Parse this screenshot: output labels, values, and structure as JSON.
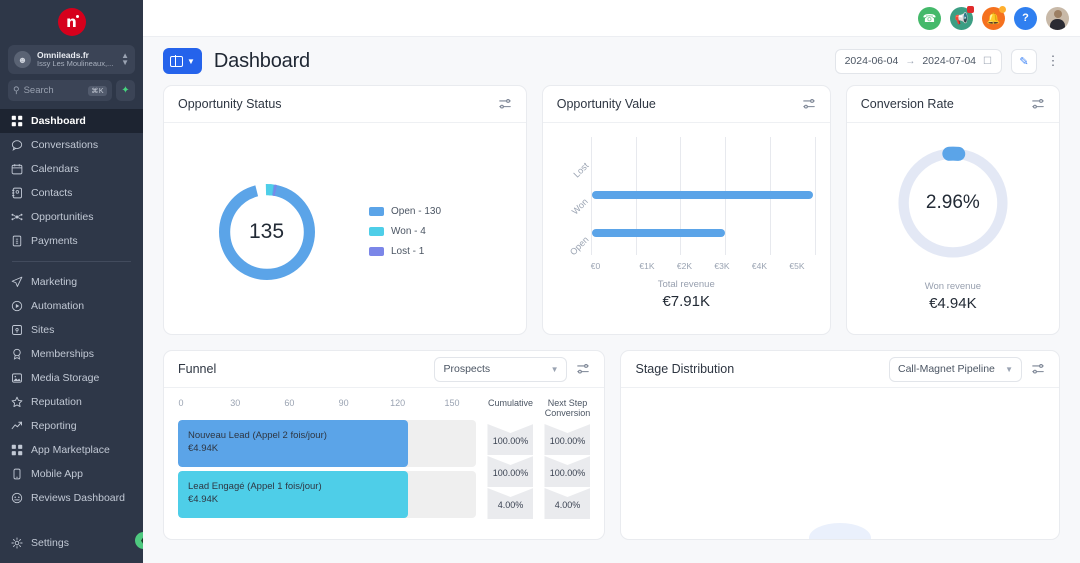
{
  "sidebar": {
    "logo_label": "n",
    "workspace": {
      "name": "Omnileads.fr",
      "location": "Issy Les Moulineaux,...",
      "avatar_icon": "user-circle-icon",
      "caret_icon": "chevron-updown-icon"
    },
    "search": {
      "placeholder": "Search",
      "shortcut": "⌘K",
      "icon": "search-icon",
      "spark_icon": "sparkle-icon"
    },
    "items": [
      {
        "label": "Dashboard",
        "icon": "grid-icon",
        "active": true
      },
      {
        "label": "Conversations",
        "icon": "chat-icon",
        "active": false
      },
      {
        "label": "Calendars",
        "icon": "calendar-icon",
        "active": false
      },
      {
        "label": "Contacts",
        "icon": "contacts-icon",
        "active": false
      },
      {
        "label": "Opportunities",
        "icon": "opportunities-icon",
        "active": false
      },
      {
        "label": "Payments",
        "icon": "payments-icon",
        "active": false
      }
    ],
    "items2": [
      {
        "label": "Marketing",
        "icon": "send-icon"
      },
      {
        "label": "Automation",
        "icon": "play-circle-icon"
      },
      {
        "label": "Sites",
        "icon": "sites-icon"
      },
      {
        "label": "Memberships",
        "icon": "badge-icon"
      },
      {
        "label": "Media Storage",
        "icon": "image-icon"
      },
      {
        "label": "Reputation",
        "icon": "star-icon"
      },
      {
        "label": "Reporting",
        "icon": "trend-up-icon"
      },
      {
        "label": "App Marketplace",
        "icon": "grid-icon"
      },
      {
        "label": "Mobile App",
        "icon": "mobile-icon"
      },
      {
        "label": "Reviews Dashboard",
        "icon": "gauge-icon"
      }
    ],
    "settings": {
      "label": "Settings",
      "icon": "gear-icon"
    },
    "collapse_icon": "chevron-left-icon"
  },
  "topbar": {
    "icons": [
      {
        "name": "phone-icon",
        "glyph": "✆",
        "color": "#44b96a",
        "badge": null
      },
      {
        "name": "megaphone-icon",
        "glyph": "📣",
        "color": "#3c9e83",
        "badge": "red"
      },
      {
        "name": "notifications-bell-icon",
        "glyph": "🔔",
        "color": "#f5711f",
        "badge": "orange"
      },
      {
        "name": "help-icon",
        "glyph": "?",
        "color": "#2f7ff0",
        "badge": null
      }
    ],
    "avatar_name": "user-avatar"
  },
  "header": {
    "view_button_label": "",
    "view_icon": "layout-panel-icon",
    "caret_icon": "chevron-down-icon",
    "title": "Dashboard",
    "date_start": "2024-06-04",
    "date_end": "2024-07-04",
    "date_arrow": "→",
    "calendar_icon": "calendar-icon",
    "edit_icon": "pencil-icon",
    "kebab_icon": "more-vertical-icon"
  },
  "cards": {
    "opportunity_status": {
      "title": "Opportunity Status",
      "settings_icon": "sliders-icon",
      "center_value": "135"
    },
    "opportunity_value": {
      "title": "Opportunity Value",
      "settings_icon": "sliders-icon",
      "footer_label": "Total revenue",
      "footer_value": "€7.91K"
    },
    "conversion_rate": {
      "title": "Conversion Rate",
      "settings_icon": "sliders-icon",
      "center_value": "2.96%",
      "footer_label": "Won revenue",
      "footer_value": "€4.94K"
    },
    "funnel": {
      "title": "Funnel",
      "select_value": "Prospects",
      "settings_icon": "sliders-icon",
      "caret_icon": "chevron-down-icon",
      "col_cumulative": "Cumulative",
      "col_next_step": "Next Step Conversion"
    },
    "stage_distribution": {
      "title": "Stage Distribution",
      "select_value": "Call-Magnet Pipeline",
      "settings_icon": "sliders-icon",
      "caret_icon": "chevron-down-icon"
    }
  },
  "chart_data": [
    {
      "type": "pie",
      "name": "opportunity-status-donut",
      "title": "Opportunity Status",
      "center_label": "135",
      "total": 135,
      "labels": [
        "Open",
        "Won",
        "Lost"
      ],
      "values": [
        130,
        4,
        1
      ],
      "legend": [
        "Open - 130",
        "Won - 4",
        "Lost - 1"
      ],
      "colors": [
        "#5BA4E8",
        "#4ECEE8",
        "#7B86E8"
      ],
      "legend_position": "right"
    },
    {
      "type": "bar",
      "name": "opportunity-value-bars",
      "title": "Opportunity Value",
      "orientation": "horizontal",
      "categories": [
        "Lost",
        "Won",
        "Open"
      ],
      "values": [
        0,
        4.94,
        2.97
      ],
      "xlabel": "",
      "ylabel": "",
      "xlim": [
        0,
        5
      ],
      "xticks": [
        "€0",
        "€1K",
        "€2K",
        "€3K",
        "€4K",
        "€5K"
      ],
      "grid": true,
      "color": "#5BA4E8",
      "footer_label": "Total revenue",
      "footer_value": "€7.91K"
    },
    {
      "type": "pie",
      "name": "conversion-rate-gauge",
      "title": "Conversion Rate",
      "center_label": "2.96%",
      "labels": [
        "Converted",
        "Remaining"
      ],
      "values": [
        2.96,
        97.04
      ],
      "colors": [
        "#5BA4E8",
        "#E3E8F5"
      ],
      "footer_label": "Won revenue",
      "footer_value": "€4.94K"
    },
    {
      "type": "bar",
      "name": "funnel-stages",
      "title": "Funnel",
      "orientation": "horizontal",
      "xticks": [
        "0",
        "30",
        "60",
        "90",
        "120",
        "150"
      ],
      "xlim": [
        0,
        165
      ],
      "stages": [
        {
          "label": "Nouveau Lead (Appel 2 fois/jour)",
          "value": "€4.94K",
          "count": 125,
          "color": "#5BA4E8",
          "cumulative": "100.00%",
          "next_step": "100.00%"
        },
        {
          "label": "Lead Engagé (Appel 1 fois/jour)",
          "value": "€4.94K",
          "count": 125,
          "color": "#4ECEE8",
          "cumulative": "100.00%",
          "next_step": "100.00%"
        },
        {
          "label": "",
          "value": "",
          "count": 5,
          "color": "#7B86E8",
          "cumulative": "4.00%",
          "next_step": "4.00%"
        }
      ],
      "col_headers": [
        "Cumulative",
        "Next Step Conversion"
      ]
    }
  ]
}
